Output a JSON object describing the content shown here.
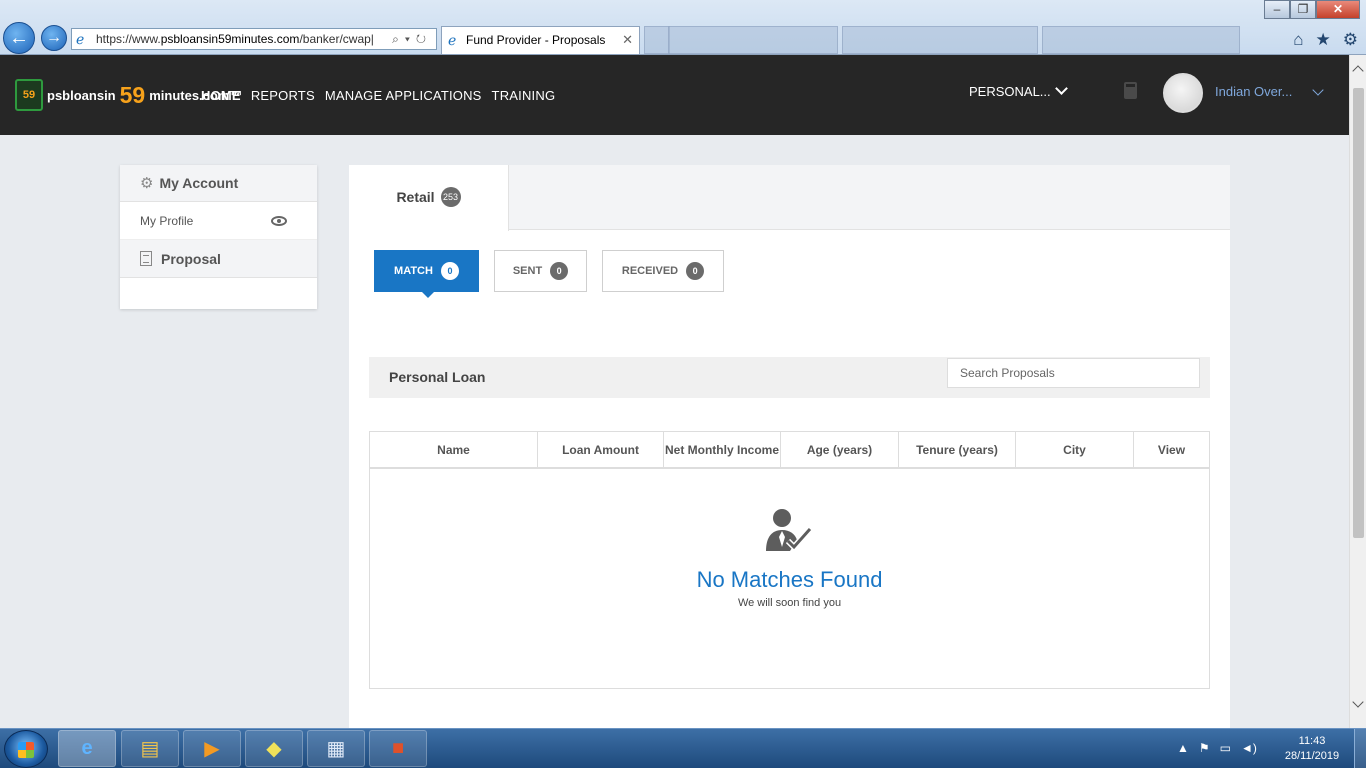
{
  "browser": {
    "address_scheme": "https://www.",
    "address_host": "psbloansin59minutes.com",
    "address_path": "/banker/cwap|",
    "tab_title": "Fund Provider - Proposals",
    "tab_close": "✕"
  },
  "header": {
    "logo": {
      "badge": "59",
      "text_a": "psbloansin",
      "text_59": "59",
      "text_b": "minutes.com™"
    },
    "nav": [
      "HOME",
      "REPORTS",
      "MANAGE APPLICATIONS",
      "TRAINING"
    ],
    "product_dropdown": "PERSONAL...",
    "user_name": "Indian Over..."
  },
  "sidebar": {
    "account_label": "My Account",
    "profile_label": "My Profile",
    "proposal_label": "Proposal"
  },
  "main": {
    "tab_retail": {
      "label": "Retail",
      "count": "253"
    },
    "filters": [
      {
        "label": "MATCH",
        "count": "0"
      },
      {
        "label": "SENT",
        "count": "0"
      },
      {
        "label": "RECEIVED",
        "count": "0"
      }
    ],
    "section_title": "Personal Loan",
    "search_placeholder": "Search Proposals",
    "columns": [
      "Name",
      "Loan Amount",
      "Net Monthly Income",
      "Age (years)",
      "Tenure (years)",
      "City",
      "View"
    ],
    "empty_title": "No Matches Found",
    "empty_subtitle": "We will soon find you"
  },
  "taskbar": {
    "time": "11:43",
    "date": "28/11/2019"
  },
  "colors": {
    "accent": "#1976c5",
    "header_bg": "#262626",
    "logo_orange": "#f7a21b"
  }
}
